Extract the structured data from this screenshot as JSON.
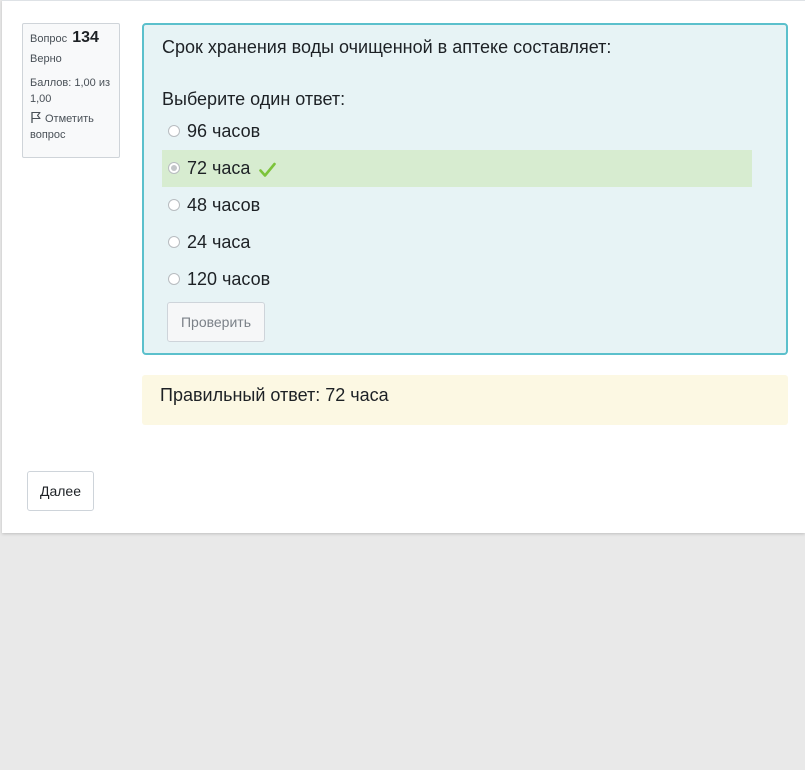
{
  "question_info": {
    "number_label": "Вопрос",
    "number": "134",
    "state": "Верно",
    "grade": "Баллов: 1,00 из 1,00",
    "flag_label": "Отметить вопрос"
  },
  "question": {
    "text": "Срок хранения воды очищенной в аптеке составляет:",
    "prompt": "Выберите один ответ:",
    "answers": [
      {
        "label": "96 часов",
        "selected": false,
        "correct": false
      },
      {
        "label": "72 часа",
        "selected": true,
        "correct": true
      },
      {
        "label": "48 часов",
        "selected": false,
        "correct": false
      },
      {
        "label": "24 часа",
        "selected": false,
        "correct": false
      },
      {
        "label": "120 часов",
        "selected": false,
        "correct": false
      }
    ],
    "check_button": "Проверить"
  },
  "feedback": {
    "right_answer": "Правильный ответ: 72 часа"
  },
  "navigation": {
    "next_button": "Далее"
  },
  "colors": {
    "correct_bg": "#d7ecd0",
    "check_icon": "#7cc33a",
    "feedback_bg": "#fcf8e3",
    "formulation_border": "#5bc0cc"
  },
  "icons": {
    "flag": "flag-icon",
    "correct": "checkmark-icon"
  }
}
